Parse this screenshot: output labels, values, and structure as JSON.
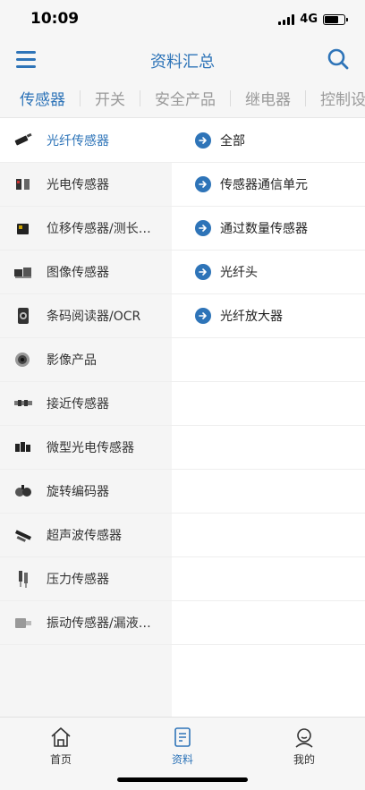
{
  "status_bar": {
    "time": "10:09",
    "network": "4G"
  },
  "header": {
    "title": "资料汇总",
    "menu_icon": "hamburger-menu-icon",
    "search_icon": "search-icon"
  },
  "tabs": [
    {
      "label": "传感器",
      "active": true
    },
    {
      "label": "开关"
    },
    {
      "label": "安全产品"
    },
    {
      "label": "继电器"
    },
    {
      "label": "控制设"
    }
  ],
  "categories": [
    {
      "label": "光纤传感器",
      "active": true
    },
    {
      "label": "光电传感器"
    },
    {
      "label": "位移传感器/测长传感器"
    },
    {
      "label": "图像传感器"
    },
    {
      "label": "条码阅读器/OCR"
    },
    {
      "label": "影像产品"
    },
    {
      "label": "接近传感器"
    },
    {
      "label": "微型光电传感器"
    },
    {
      "label": "旋转编码器"
    },
    {
      "label": "超声波传感器"
    },
    {
      "label": "压力传感器"
    },
    {
      "label": "振动传感器/漏液传感器"
    }
  ],
  "subcategories": [
    {
      "label": "全部"
    },
    {
      "label": "传感器通信单元"
    },
    {
      "label": "通过数量传感器"
    },
    {
      "label": "光纤头"
    },
    {
      "label": "光纤放大器"
    }
  ],
  "bottom_nav": [
    {
      "label": "首页",
      "icon": "home-icon"
    },
    {
      "label": "资料",
      "icon": "document-icon",
      "active": true
    },
    {
      "label": "我的",
      "icon": "profile-icon"
    }
  ],
  "colors": {
    "accent": "#2e74b8",
    "background": "#f6f6f6"
  }
}
